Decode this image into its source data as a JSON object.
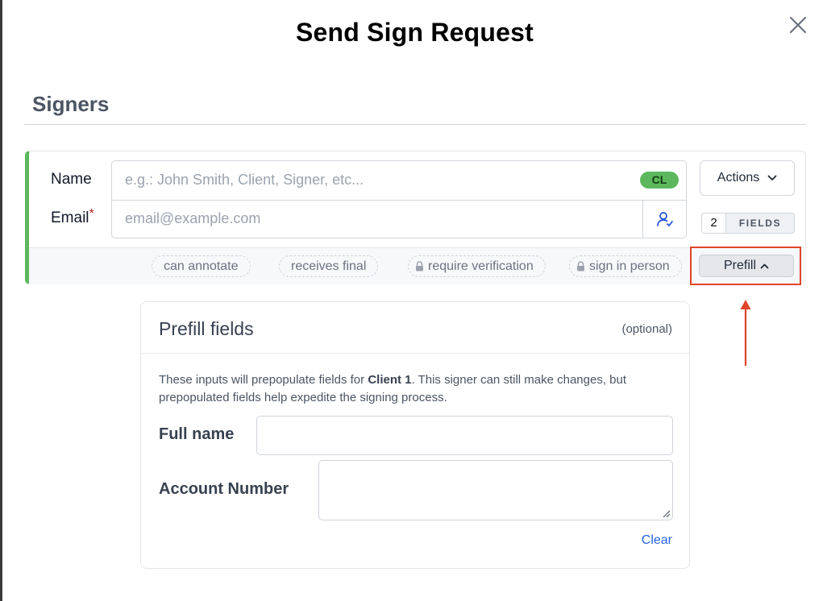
{
  "dialog": {
    "title": "Send Sign Request"
  },
  "signers": {
    "heading": "Signers",
    "name_label": "Name",
    "email_label": "Email",
    "required_mark": "*",
    "name_placeholder": "e.g.: John Smith, Client, Signer, etc...",
    "email_placeholder": "email@example.com",
    "initials_badge": "CL",
    "actions_label": "Actions",
    "fields_count": "2",
    "fields_label": "FIELDS",
    "chips": [
      {
        "label": "can annotate",
        "locked": false
      },
      {
        "label": "receives final",
        "locked": false
      },
      {
        "label": "require verification",
        "locked": true
      },
      {
        "label": "sign in person",
        "locked": true
      }
    ],
    "prefill_label": "Prefill",
    "accent_color": "#5cb85c"
  },
  "prefill_panel": {
    "title": "Prefill fields",
    "optional_note": "(optional)",
    "desc_before": "These inputs will prepopulate fields for ",
    "desc_signer": "Client 1",
    "desc_after": ". This signer can still make changes, but prepopulated fields help expedite the signing process.",
    "full_name_label": "Full name",
    "full_name_value": "",
    "account_number_label": "Account Number",
    "account_number_value": "",
    "clear_label": "Clear"
  },
  "annotation": {
    "highlight_color": "#e0442a"
  },
  "icons": {
    "close": "close-icon",
    "contact": "user-check-icon",
    "actions_chevron": "chevron-down-icon",
    "prefill_chevron": "chevron-up-icon",
    "lock": "lock-icon",
    "resize": "resize-grip-icon"
  }
}
